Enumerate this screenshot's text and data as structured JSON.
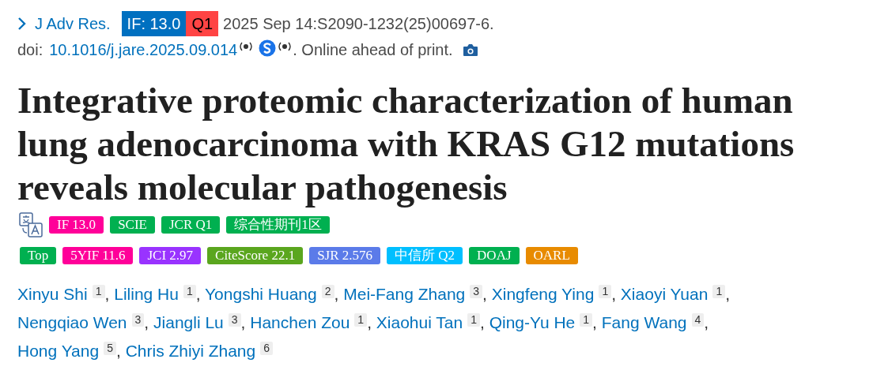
{
  "citation": {
    "journal": "J Adv Res.",
    "if_badge": "IF: 13.0",
    "quartile_badge": "Q1",
    "date": "2025 Sep 14:S2090-1232(25)00697-6."
  },
  "doi": {
    "label": "doi:",
    "link": "10.1016/j.jare.2025.09.014",
    "status": ". Online ahead of print."
  },
  "title": "Integrative proteomic characterization of human lung adenocarcinoma with KRAS G12 mutations reveals molecular pathogenesis",
  "title_badges": [
    {
      "text": "IF 13.0",
      "color": "#ff0099"
    },
    {
      "text": "SCIE",
      "color": "#00b050"
    },
    {
      "text": "JCR Q1",
      "color": "#00b050"
    },
    {
      "text": "综合性期刊1区",
      "color": "#00b050"
    }
  ],
  "metric_badges": [
    {
      "text": "Top",
      "color": "#00b050"
    },
    {
      "text": "5YIF 11.6",
      "color": "#ff0099"
    },
    {
      "text": "JCI 2.97",
      "color": "#9933ff"
    },
    {
      "text": "CiteScore 22.1",
      "color": "#5aa61e"
    },
    {
      "text": "SJR 2.576",
      "color": "#5b7be9"
    },
    {
      "text": "中信所 Q2",
      "color": "#00bfff"
    },
    {
      "text": "DOAJ",
      "color": "#00b050"
    },
    {
      "text": "OARL",
      "color": "#e88b00"
    }
  ],
  "authors": [
    {
      "name": "Xinyu Shi",
      "affiliation": "1",
      "separator": ","
    },
    {
      "name": "Liling Hu",
      "affiliation": "1",
      "separator": ","
    },
    {
      "name": "Yongshi Huang",
      "affiliation": "2",
      "separator": ","
    },
    {
      "name": "Mei-Fang Zhang",
      "affiliation": "3",
      "separator": ","
    },
    {
      "name": "Xingfeng Ying",
      "affiliation": "1",
      "separator": ","
    },
    {
      "name": "Xiaoyi Yuan",
      "affiliation": "1",
      "separator": ","
    },
    {
      "name": "Nengqiao Wen",
      "affiliation": "3",
      "separator": ","
    },
    {
      "name": "Jiangli Lu",
      "affiliation": "3",
      "separator": ","
    },
    {
      "name": "Hanchen Zou",
      "affiliation": "1",
      "separator": ","
    },
    {
      "name": "Xiaohui Tan",
      "affiliation": "1",
      "separator": ","
    },
    {
      "name": "Qing-Yu He",
      "affiliation": "1",
      "separator": ","
    },
    {
      "name": "Fang Wang",
      "affiliation": "4",
      "separator": ","
    },
    {
      "name": "Hong Yang",
      "affiliation": "5",
      "separator": ","
    },
    {
      "name": "Chris Zhiyi Zhang",
      "affiliation": "6"
    }
  ]
}
